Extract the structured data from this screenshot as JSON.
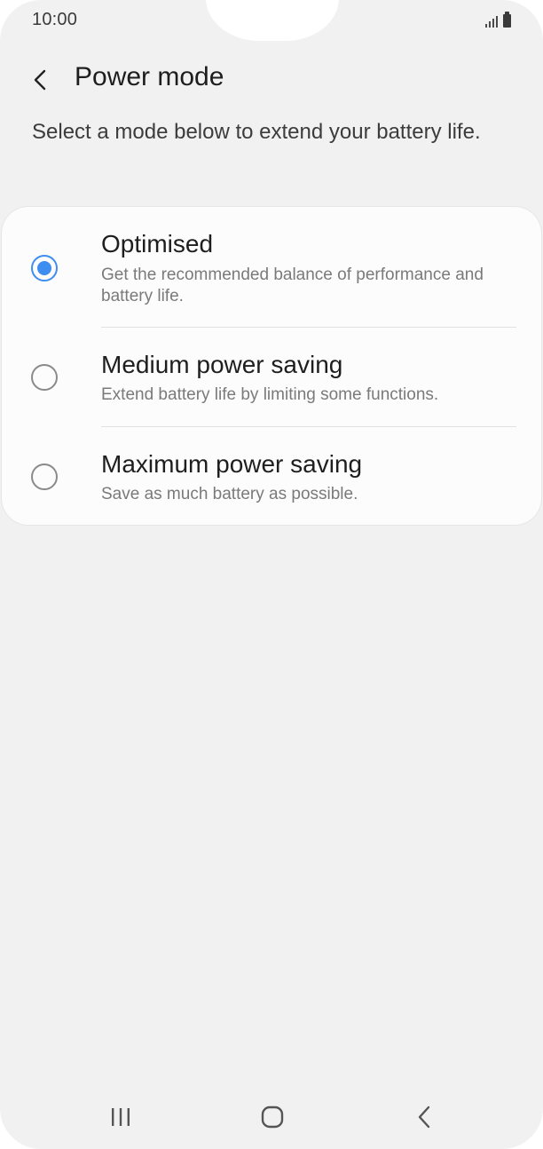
{
  "status_bar": {
    "time": "10:00"
  },
  "header": {
    "title": "Power mode"
  },
  "description": "Select a mode below to extend your battery life.",
  "options": [
    {
      "title": "Optimised",
      "subtitle": "Get the recommended balance of performance and battery life.",
      "selected": true
    },
    {
      "title": "Medium power saving",
      "subtitle": "Extend battery life by limiting some functions.",
      "selected": false
    },
    {
      "title": "Maximum power saving",
      "subtitle": "Save as much battery as possible.",
      "selected": false
    }
  ],
  "icons": {
    "back": "chevron-left-icon",
    "signal": "signal-icon",
    "battery": "battery-icon",
    "nav_recents": "recent-apps-icon",
    "nav_home": "home-icon",
    "nav_back": "back-icon"
  },
  "colors": {
    "accent": "#3e8df0",
    "background": "#f1f1f1",
    "card": "#fcfcfc"
  }
}
